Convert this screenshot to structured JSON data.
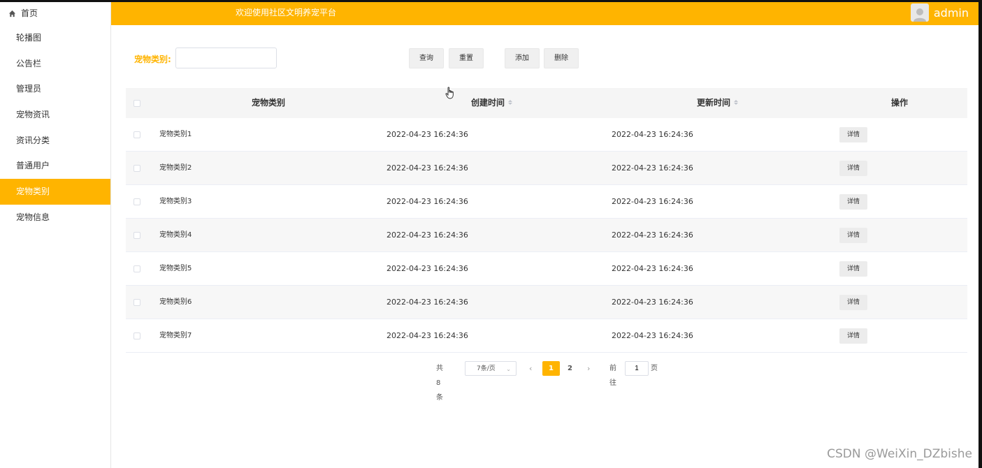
{
  "header": {
    "welcome": "欢迎使用社区文明养宠平台",
    "username": "admin"
  },
  "sidebar": {
    "home": "首页",
    "items": [
      "轮播图",
      "公告栏",
      "管理员",
      "宠物资讯",
      "资讯分类",
      "普通用户",
      "宠物类别",
      "宠物信息"
    ],
    "active_index": 6
  },
  "search": {
    "label": "宠物类别:",
    "value": "",
    "buttons": {
      "query": "查询",
      "reset": "重置",
      "add": "添加",
      "delete": "删除"
    }
  },
  "table": {
    "headers": {
      "name": "宠物类别",
      "created": "创建时间",
      "updated": "更新时间",
      "action": "操作"
    },
    "rows": [
      {
        "name": "宠物类别1",
        "created": "2022-04-23 16:24:36",
        "updated": "2022-04-23 16:24:36",
        "action": "详情"
      },
      {
        "name": "宠物类别2",
        "created": "2022-04-23 16:24:36",
        "updated": "2022-04-23 16:24:36",
        "action": "详情"
      },
      {
        "name": "宠物类别3",
        "created": "2022-04-23 16:24:36",
        "updated": "2022-04-23 16:24:36",
        "action": "详情"
      },
      {
        "name": "宠物类别4",
        "created": "2022-04-23 16:24:36",
        "updated": "2022-04-23 16:24:36",
        "action": "详情"
      },
      {
        "name": "宠物类别5",
        "created": "2022-04-23 16:24:36",
        "updated": "2022-04-23 16:24:36",
        "action": "详情"
      },
      {
        "name": "宠物类别6",
        "created": "2022-04-23 16:24:36",
        "updated": "2022-04-23 16:24:36",
        "action": "详情"
      },
      {
        "name": "宠物类别7",
        "created": "2022-04-23 16:24:36",
        "updated": "2022-04-23 16:24:36",
        "action": "详情"
      }
    ]
  },
  "pagination": {
    "total": "共 8 条",
    "page_size": "7条/页",
    "pages": [
      "1",
      "2"
    ],
    "current_page": "1",
    "goto_prefix": "前往",
    "goto_value": "1",
    "goto_suffix": "页"
  },
  "watermark": "CSDN @WeiXin_DZbishe",
  "colors": {
    "accent": "#FFB400"
  }
}
